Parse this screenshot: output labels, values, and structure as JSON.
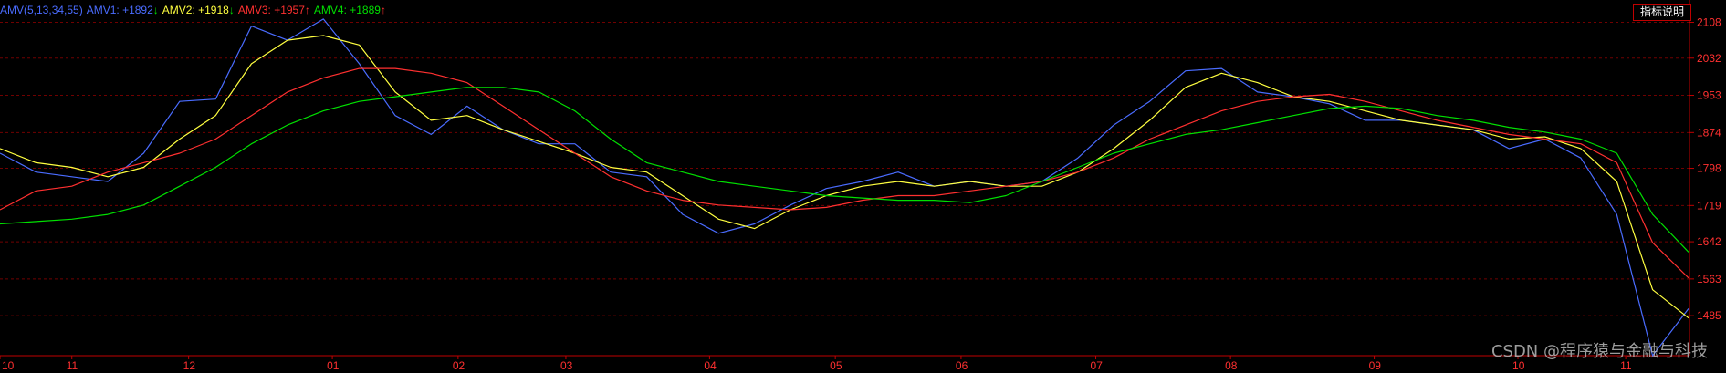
{
  "indicator_help_label": "指标说明",
  "watermark": "CSDN @程序猿与金融与科技",
  "legend": [
    {
      "text": "AMV(5,13,34,55)",
      "color": "#4a6cff"
    },
    {
      "text": "AMV1: +1892",
      "color": "#4a6cff",
      "arrow": "↓",
      "arrow_color": "#00e000"
    },
    {
      "text": "AMV2: +1918",
      "color": "#ffff40",
      "arrow": "↓",
      "arrow_color": "#00e000"
    },
    {
      "text": "AMV3: +1957",
      "color": "#ff3030",
      "arrow": "↑",
      "arrow_color": "#ff3030"
    },
    {
      "text": "AMV4: +1889",
      "color": "#00e000",
      "arrow": "↑",
      "arrow_color": "#ff3030"
    }
  ],
  "colors": {
    "axis": "#c00000",
    "grid": "#700000",
    "tick_text": "#ff3030",
    "background": "#000000"
  },
  "chart_data": {
    "type": "line",
    "title": "AMV(5,13,34,55)",
    "ylim": [
      1400,
      2140
    ],
    "y_ticks": [
      2108,
      2032,
      1953,
      1874,
      1798,
      1719,
      1642,
      1563,
      1485
    ],
    "x_ticks": [
      {
        "label": "10",
        "x": 0
      },
      {
        "label": "11",
        "x": 8
      },
      {
        "label": "12",
        "x": 21
      },
      {
        "label": "01",
        "x": 37
      },
      {
        "label": "02",
        "x": 51
      },
      {
        "label": "03",
        "x": 63
      },
      {
        "label": "04",
        "x": 79
      },
      {
        "label": "05",
        "x": 93
      },
      {
        "label": "06",
        "x": 107
      },
      {
        "label": "07",
        "x": 122
      },
      {
        "label": "08",
        "x": 137
      },
      {
        "label": "09",
        "x": 153
      },
      {
        "label": "10",
        "x": 169
      },
      {
        "label": "11",
        "x": 181
      }
    ],
    "x": [
      0,
      4,
      8,
      12,
      16,
      20,
      24,
      28,
      32,
      36,
      40,
      44,
      48,
      52,
      56,
      60,
      64,
      68,
      72,
      76,
      80,
      84,
      88,
      92,
      96,
      100,
      104,
      108,
      112,
      116,
      120,
      124,
      128,
      132,
      136,
      140,
      144,
      148,
      152,
      156,
      160,
      164,
      168,
      172,
      176,
      180,
      184,
      188
    ],
    "series": [
      {
        "name": "AMV1",
        "color": "#4a6cff",
        "values": [
          1830,
          1790,
          1780,
          1770,
          1830,
          1940,
          1945,
          2100,
          2070,
          2115,
          2020,
          1910,
          1870,
          1930,
          1880,
          1850,
          1850,
          1790,
          1780,
          1700,
          1660,
          1680,
          1720,
          1755,
          1770,
          1790,
          1760,
          1770,
          1760,
          1770,
          1820,
          1890,
          1940,
          2005,
          2010,
          1960,
          1950,
          1935,
          1900,
          1900,
          1890,
          1880,
          1840,
          1860,
          1820,
          1700,
          1400,
          1500
        ]
      },
      {
        "name": "AMV2",
        "color": "#ffff40",
        "values": [
          1840,
          1810,
          1800,
          1780,
          1800,
          1860,
          1910,
          2020,
          2070,
          2080,
          2060,
          1960,
          1900,
          1910,
          1880,
          1855,
          1830,
          1800,
          1790,
          1740,
          1690,
          1670,
          1710,
          1740,
          1760,
          1770,
          1760,
          1770,
          1760,
          1760,
          1790,
          1840,
          1900,
          1970,
          2000,
          1980,
          1950,
          1940,
          1920,
          1900,
          1890,
          1880,
          1860,
          1865,
          1840,
          1770,
          1540,
          1480
        ]
      },
      {
        "name": "AMV3",
        "color": "#ff3030",
        "values": [
          1710,
          1750,
          1760,
          1790,
          1810,
          1830,
          1860,
          1910,
          1960,
          1990,
          2010,
          2010,
          2000,
          1980,
          1930,
          1880,
          1830,
          1780,
          1750,
          1730,
          1720,
          1715,
          1710,
          1715,
          1730,
          1740,
          1740,
          1750,
          1760,
          1770,
          1790,
          1820,
          1860,
          1890,
          1920,
          1940,
          1950,
          1955,
          1940,
          1920,
          1900,
          1885,
          1870,
          1860,
          1850,
          1810,
          1640,
          1565
        ]
      },
      {
        "name": "AMV4",
        "color": "#00e000",
        "values": [
          1680,
          1685,
          1690,
          1700,
          1720,
          1760,
          1800,
          1850,
          1890,
          1920,
          1940,
          1950,
          1960,
          1970,
          1970,
          1960,
          1920,
          1860,
          1810,
          1790,
          1770,
          1760,
          1750,
          1740,
          1735,
          1730,
          1730,
          1725,
          1740,
          1770,
          1800,
          1830,
          1850,
          1870,
          1880,
          1895,
          1910,
          1925,
          1930,
          1925,
          1910,
          1900,
          1885,
          1875,
          1860,
          1830,
          1700,
          1620
        ]
      }
    ]
  }
}
